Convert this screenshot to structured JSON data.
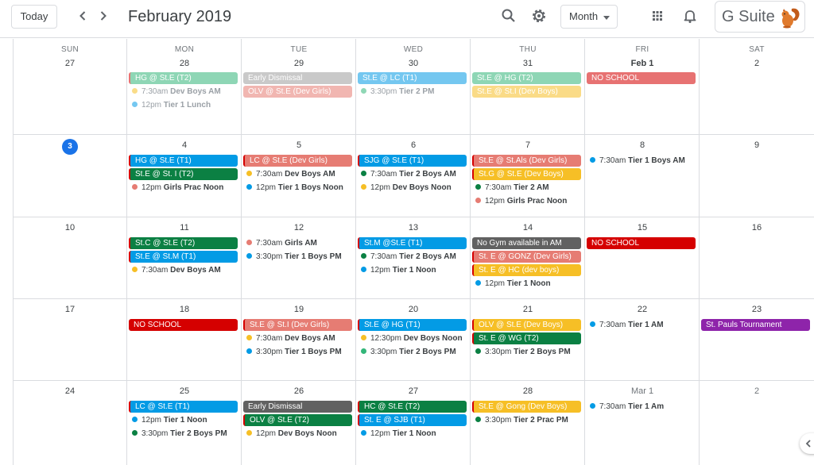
{
  "header": {
    "today_label": "Today",
    "prev_icon": "chevron-left-icon",
    "next_icon": "chevron-right-icon",
    "title": "February 2019",
    "search_icon": "search-icon",
    "settings_icon": "gear-icon",
    "view_label": "Month",
    "apps_icon": "apps-grid-icon",
    "notifications_icon": "bell-icon",
    "brand": "G Suite",
    "brand_logo": "squirrel-logo"
  },
  "weekdays": [
    "SUN",
    "MON",
    "TUE",
    "WED",
    "THU",
    "FRI",
    "SAT"
  ],
  "colors": {
    "sage": "#33b679",
    "peacock": "#039be5",
    "basil": "#0b8043",
    "flamingo": "#e67c73",
    "banana": "#f6bf26",
    "tomato": "#d50000",
    "graphite": "#616161",
    "grape": "#8e24aa",
    "today": "#1a73e8"
  },
  "weeks": [
    {
      "days": [
        {
          "label": "27",
          "dim": false,
          "events": []
        },
        {
          "label": "28",
          "dim": false,
          "events": [
            {
              "kind": "chip",
              "title": "HG @ St.E (T2)",
              "color": "#33b679",
              "stripe": true,
              "faded": true
            },
            {
              "kind": "timed",
              "time": "7:30am",
              "title": "Dev Boys AM",
              "color": "#f6bf26",
              "faded": true
            },
            {
              "kind": "timed",
              "time": "12pm",
              "title": "Tier 1 Lunch",
              "color": "#039be5",
              "faded": true
            }
          ]
        },
        {
          "label": "29",
          "dim": false,
          "events": [
            {
              "kind": "chip",
              "title": "Early Dismissal",
              "color": "#9e9e9e",
              "stripe": false,
              "faded": true
            },
            {
              "kind": "chip",
              "title": "OLV @ St.E (Dev Girls)",
              "color": "#e67c73",
              "stripe": false,
              "faded": true
            }
          ]
        },
        {
          "label": "30",
          "dim": false,
          "events": [
            {
              "kind": "chip",
              "title": "St.E @ LC (T1)",
              "color": "#039be5",
              "stripe": false,
              "faded": true
            },
            {
              "kind": "timed",
              "time": "3:30pm",
              "title": "Tier 2 PM",
              "color": "#33b679",
              "faded": true
            }
          ]
        },
        {
          "label": "31",
          "dim": false,
          "events": [
            {
              "kind": "chip",
              "title": "St.E @ HG (T2)",
              "color": "#33b679",
              "stripe": false,
              "faded": true
            },
            {
              "kind": "chip",
              "title": "St.E @ St.I (Dev Boys)",
              "color": "#f6bf26",
              "stripe": false,
              "faded": true
            }
          ]
        },
        {
          "label": "Feb 1",
          "dim": false,
          "bold": true,
          "events": [
            {
              "kind": "chip",
              "title": "NO SCHOOL",
              "color": "#d50000",
              "stripe": false,
              "faded": true
            }
          ]
        },
        {
          "label": "2",
          "dim": false,
          "events": []
        }
      ]
    },
    {
      "days": [
        {
          "label": "3",
          "today": true,
          "events": []
        },
        {
          "label": "4",
          "events": [
            {
              "kind": "chip",
              "title": "HG @ St.E (T1)",
              "color": "#039be5",
              "stripe": true
            },
            {
              "kind": "chip",
              "title": "St.E @ St. I (T2)",
              "color": "#0b8043",
              "stripe": true
            },
            {
              "kind": "timed",
              "time": "12pm",
              "title": "Girls Prac Noon",
              "color": "#e67c73"
            }
          ]
        },
        {
          "label": "5",
          "events": [
            {
              "kind": "chip",
              "title": "LC @ St.E (Dev Girls)",
              "color": "#e67c73",
              "stripe": true
            },
            {
              "kind": "timed",
              "time": "7:30am",
              "title": "Dev Boys AM",
              "color": "#f6bf26"
            },
            {
              "kind": "timed",
              "time": "12pm",
              "title": "Tier 1 Boys Noon",
              "color": "#039be5"
            }
          ]
        },
        {
          "label": "6",
          "events": [
            {
              "kind": "chip",
              "title": "SJG @ St.E (T1)",
              "color": "#039be5",
              "stripe": true
            },
            {
              "kind": "timed",
              "time": "7:30am",
              "title": "Tier 2 Boys AM",
              "color": "#0b8043"
            },
            {
              "kind": "timed",
              "time": "12pm",
              "title": "Dev Boys Noon",
              "color": "#f6bf26"
            }
          ]
        },
        {
          "label": "7",
          "events": [
            {
              "kind": "chip",
              "title": "St.E @ St.Als (Dev Girls)",
              "color": "#e67c73",
              "stripe": true
            },
            {
              "kind": "chip",
              "title": "St.G @ St.E (Dev Boys)",
              "color": "#f6bf26",
              "stripe": true
            },
            {
              "kind": "timed",
              "time": "7:30am",
              "title": "Tier 2 AM",
              "color": "#0b8043"
            },
            {
              "kind": "timed",
              "time": "12pm",
              "title": "Girls Prac Noon",
              "color": "#e67c73"
            }
          ]
        },
        {
          "label": "8",
          "events": [
            {
              "kind": "timed",
              "time": "7:30am",
              "title": "Tier 1 Boys AM",
              "color": "#039be5"
            }
          ]
        },
        {
          "label": "9",
          "events": []
        }
      ]
    },
    {
      "days": [
        {
          "label": "10",
          "events": []
        },
        {
          "label": "11",
          "events": [
            {
              "kind": "chip",
              "title": "St.C @ St.E (T2)",
              "color": "#0b8043",
              "stripe": true
            },
            {
              "kind": "chip",
              "title": "St.E @ St.M (T1)",
              "color": "#039be5",
              "stripe": true
            },
            {
              "kind": "timed",
              "time": "7:30am",
              "title": "Dev Boys AM",
              "color": "#f6bf26"
            }
          ]
        },
        {
          "label": "12",
          "events": [
            {
              "kind": "timed",
              "time": "7:30am",
              "title": "Girls AM",
              "color": "#e67c73"
            },
            {
              "kind": "timed",
              "time": "3:30pm",
              "title": "Tier 1 Boys PM",
              "color": "#039be5"
            }
          ]
        },
        {
          "label": "13",
          "events": [
            {
              "kind": "chip",
              "title": "St.M @St.E (T1)",
              "color": "#039be5",
              "stripe": true
            },
            {
              "kind": "timed",
              "time": "7:30am",
              "title": "Tier 2 Boys AM",
              "color": "#0b8043"
            },
            {
              "kind": "timed",
              "time": "12pm",
              "title": "Tier 1 Noon",
              "color": "#039be5"
            }
          ]
        },
        {
          "label": "14",
          "events": [
            {
              "kind": "chip",
              "title": "No Gym available in AM",
              "color": "#616161",
              "stripe": false
            },
            {
              "kind": "chip",
              "title": "St. E @ GONZ (Dev Girls)",
              "color": "#e67c73",
              "stripe": true
            },
            {
              "kind": "chip",
              "title": "St. E @ HC (dev boys)",
              "color": "#f6bf26",
              "stripe": true
            },
            {
              "kind": "timed",
              "time": "12pm",
              "title": "Tier 1 Noon",
              "color": "#039be5"
            }
          ]
        },
        {
          "label": "15",
          "events": [
            {
              "kind": "chip",
              "title": "NO SCHOOL",
              "color": "#d50000",
              "stripe": false
            }
          ]
        },
        {
          "label": "16",
          "events": []
        }
      ]
    },
    {
      "days": [
        {
          "label": "17",
          "events": []
        },
        {
          "label": "18",
          "events": [
            {
              "kind": "chip",
              "title": "NO SCHOOL",
              "color": "#d50000",
              "stripe": false
            }
          ]
        },
        {
          "label": "19",
          "events": [
            {
              "kind": "chip",
              "title": "St.E @ St.I (Dev Girls)",
              "color": "#e67c73",
              "stripe": true
            },
            {
              "kind": "timed",
              "time": "7:30am",
              "title": "Dev Boys AM",
              "color": "#f6bf26"
            },
            {
              "kind": "timed",
              "time": "3:30pm",
              "title": "Tier 1 Boys PM",
              "color": "#039be5"
            }
          ]
        },
        {
          "label": "20",
          "events": [
            {
              "kind": "chip",
              "title": "St.E @ HG (T1)",
              "color": "#039be5",
              "stripe": true
            },
            {
              "kind": "timed",
              "time": "12:30pm",
              "title": "Dev Boys Noon",
              "color": "#f6bf26"
            },
            {
              "kind": "timed",
              "time": "3:30pm",
              "title": "Tier 2 Boys PM",
              "color": "#33b679"
            }
          ]
        },
        {
          "label": "21",
          "events": [
            {
              "kind": "chip",
              "title": "OLV @ St.E (Dev Boys)",
              "color": "#f6bf26",
              "stripe": true
            },
            {
              "kind": "chip",
              "title": "St. E @ WG (T2)",
              "color": "#0b8043",
              "stripe": true
            },
            {
              "kind": "timed",
              "time": "3:30pm",
              "title": "Tier 2 Boys PM",
              "color": "#0b8043"
            }
          ]
        },
        {
          "label": "22",
          "events": [
            {
              "kind": "timed",
              "time": "7:30am",
              "title": "Tier 1 AM",
              "color": "#039be5"
            }
          ]
        },
        {
          "label": "23",
          "events": [
            {
              "kind": "chip",
              "title": "St. Pauls Tournament",
              "color": "#8e24aa",
              "stripe": false
            }
          ]
        }
      ]
    },
    {
      "days": [
        {
          "label": "24",
          "events": []
        },
        {
          "label": "25",
          "events": [
            {
              "kind": "chip",
              "title": "LC @ St.E (T1)",
              "color": "#039be5",
              "stripe": true
            },
            {
              "kind": "timed",
              "time": "12pm",
              "title": "Tier 1 Noon",
              "color": "#039be5"
            },
            {
              "kind": "timed",
              "time": "3:30pm",
              "title": "Tier 2 Boys PM",
              "color": "#0b8043"
            }
          ]
        },
        {
          "label": "26",
          "events": [
            {
              "kind": "chip",
              "title": "Early Dismissal",
              "color": "#616161",
              "stripe": false
            },
            {
              "kind": "chip",
              "title": "OLV @ St.E (T2)",
              "color": "#0b8043",
              "stripe": true
            },
            {
              "kind": "timed",
              "time": "12pm",
              "title": "Dev Boys Noon",
              "color": "#f6bf26"
            }
          ]
        },
        {
          "label": "27",
          "events": [
            {
              "kind": "chip",
              "title": "HC @ St.E (T2)",
              "color": "#0b8043",
              "stripe": true
            },
            {
              "kind": "chip",
              "title": "St. E @ SJB (T1)",
              "color": "#039be5",
              "stripe": true
            },
            {
              "kind": "timed",
              "time": "12pm",
              "title": "Tier 1 Noon",
              "color": "#039be5"
            }
          ]
        },
        {
          "label": "28",
          "events": [
            {
              "kind": "chip",
              "title": "St.E @ Gong (Dev Boys)",
              "color": "#f6bf26",
              "stripe": true
            },
            {
              "kind": "timed",
              "time": "3:30pm",
              "title": "Tier 2 Prac PM",
              "color": "#0b8043"
            }
          ]
        },
        {
          "label": "Mar 1",
          "dim": true,
          "events": [
            {
              "kind": "timed",
              "time": "7:30am",
              "title": "Tier 1 Am",
              "color": "#039be5"
            }
          ]
        },
        {
          "label": "2",
          "dim": true,
          "events": []
        }
      ]
    }
  ]
}
